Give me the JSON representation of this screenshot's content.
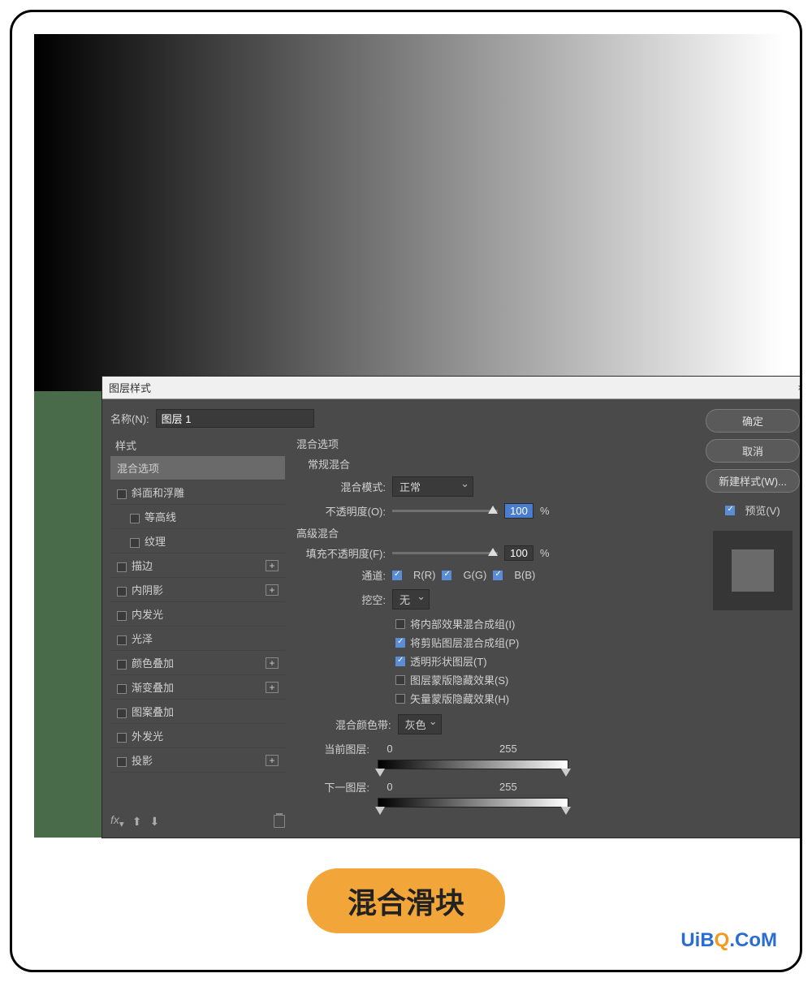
{
  "dialog": {
    "title": "图层样式",
    "name_label": "名称(N):",
    "name_value": "图层 1",
    "ok": "确定",
    "cancel": "取消",
    "new_style": "新建样式(W)...",
    "preview": "预览(V)"
  },
  "styles": {
    "header": "样式",
    "items": [
      {
        "label": "混合选项",
        "selected": true
      },
      {
        "label": "斜面和浮雕",
        "chk": false
      },
      {
        "label": "等高线",
        "sub": true,
        "chk": false
      },
      {
        "label": "纹理",
        "sub": true,
        "chk": false
      },
      {
        "label": "描边",
        "chk": false,
        "plus": true
      },
      {
        "label": "内阴影",
        "chk": false,
        "plus": true
      },
      {
        "label": "内发光",
        "chk": false
      },
      {
        "label": "光泽",
        "chk": false
      },
      {
        "label": "颜色叠加",
        "chk": false,
        "plus": true
      },
      {
        "label": "渐变叠加",
        "chk": false,
        "plus": true
      },
      {
        "label": "图案叠加",
        "chk": false
      },
      {
        "label": "外发光",
        "chk": false
      },
      {
        "label": "投影",
        "chk": false,
        "plus": true
      }
    ]
  },
  "blend": {
    "section": "混合选项",
    "general": "常规混合",
    "mode_label": "混合模式:",
    "mode_value": "正常",
    "opacity_label": "不透明度(O):",
    "opacity_value": "100",
    "percent": "%",
    "advanced": "高级混合",
    "fill_label": "填充不透明度(F):",
    "fill_value": "100",
    "channel_label": "通道:",
    "chan_r": "R(R)",
    "chan_g": "G(G)",
    "chan_b": "B(B)",
    "knockout_label": "挖空:",
    "knockout_value": "无",
    "opts": {
      "inner": "将内部效果混合成组(I)",
      "clip": "将剪贴图层混合成组(P)",
      "trans": "透明形状图层(T)",
      "lmask": "图层蒙版隐藏效果(S)",
      "vmask": "矢量蒙版隐藏效果(H)"
    },
    "blendif_label": "混合颜色带:",
    "blendif_value": "灰色",
    "this_layer": "当前图层:",
    "under_layer": "下一图层:",
    "v0": "0",
    "v255": "255"
  },
  "fxbar": {
    "fx": "fx"
  },
  "caption": "混合滑块",
  "watermark": {
    "a": "UiB",
    "b": "Q",
    "c": ".CoM"
  }
}
